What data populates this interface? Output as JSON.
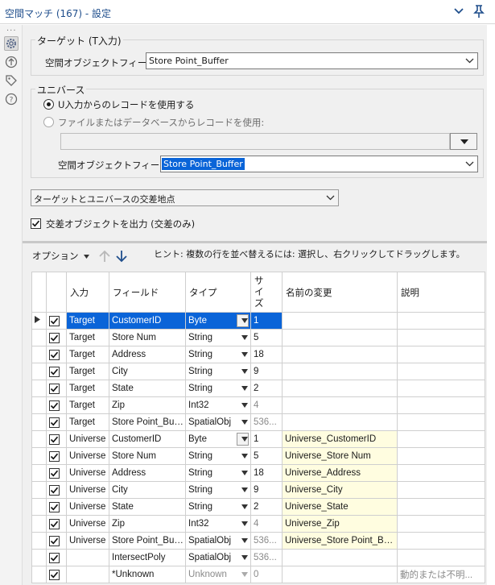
{
  "title": "空間マッチ (167) - 設定",
  "left_strip": {
    "icons": [
      "gear-icon",
      "connections-icon",
      "tag-icon",
      "help-icon"
    ]
  },
  "target": {
    "group_label": "ターゲット (T入力)",
    "field_label": "空間オブジェクトフィールド:",
    "field_value": "Store Point_Buffer"
  },
  "universe": {
    "group_label": "ユニバース",
    "radio_input_label": "U入力からのレコードを使用する",
    "radio_file_label": "ファイルまたはデータベースからレコードを使用:",
    "file_path": "",
    "field_label": "空間オブジェクトフィールド:",
    "field_value": "Store Point_Buffer"
  },
  "match_type": "ターゲットとユニバースの交差地点",
  "output_intersection": {
    "label": "交差オブジェクトを出力 (交差のみ)",
    "checked": true
  },
  "grid": {
    "options_label": "オプション",
    "hint": "ヒント: 複数の行を並べ替えるには: 選択し、右クリックしてドラッグします。",
    "columns": [
      "入力",
      "フィールド",
      "タイプ",
      "サイズ",
      "名前の変更",
      "説明"
    ],
    "rows": [
      {
        "input": "Target",
        "field": "CustomerID",
        "type": "Byte",
        "size": "1",
        "rename": "",
        "desc": ""
      },
      {
        "input": "Target",
        "field": "Store Num",
        "type": "String",
        "size": "5",
        "rename": "",
        "desc": ""
      },
      {
        "input": "Target",
        "field": "Address",
        "type": "String",
        "size": "18",
        "rename": "",
        "desc": ""
      },
      {
        "input": "Target",
        "field": "City",
        "type": "String",
        "size": "9",
        "rename": "",
        "desc": ""
      },
      {
        "input": "Target",
        "field": "State",
        "type": "String",
        "size": "2",
        "rename": "",
        "desc": ""
      },
      {
        "input": "Target",
        "field": "Zip",
        "type": "Int32",
        "size": "4",
        "rename": "",
        "desc": ""
      },
      {
        "input": "Target",
        "field": "Store Point_Buffer",
        "type": "SpatialObj",
        "size": "536...",
        "rename": "",
        "desc": ""
      },
      {
        "input": "Universe",
        "field": "CustomerID",
        "type": "Byte",
        "size": "1",
        "rename": "Universe_CustomerID",
        "desc": ""
      },
      {
        "input": "Universe",
        "field": "Store Num",
        "type": "String",
        "size": "5",
        "rename": "Universe_Store Num",
        "desc": ""
      },
      {
        "input": "Universe",
        "field": "Address",
        "type": "String",
        "size": "18",
        "rename": "Universe_Address",
        "desc": ""
      },
      {
        "input": "Universe",
        "field": "City",
        "type": "String",
        "size": "9",
        "rename": "Universe_City",
        "desc": ""
      },
      {
        "input": "Universe",
        "field": "State",
        "type": "String",
        "size": "2",
        "rename": "Universe_State",
        "desc": ""
      },
      {
        "input": "Universe",
        "field": "Zip",
        "type": "Int32",
        "size": "4",
        "rename": "Universe_Zip",
        "desc": ""
      },
      {
        "input": "Universe",
        "field": "Store Point_Buffer",
        "type": "SpatialObj",
        "size": "536...",
        "rename": "Universe_Store Point_Buffer",
        "desc": ""
      },
      {
        "input": "",
        "field": "IntersectPoly",
        "type": "SpatialObj",
        "size": "536...",
        "rename": "",
        "desc": ""
      },
      {
        "input": "",
        "field": "*Unknown",
        "type": "Unknown",
        "size": "0",
        "rename": "",
        "desc": "動的または不明..."
      }
    ]
  }
}
